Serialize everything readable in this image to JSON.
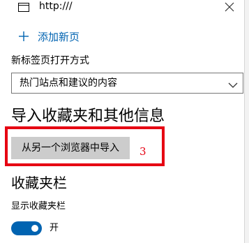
{
  "tab": {
    "url": "http:///",
    "page_icon": "page-icon",
    "close_icon": "close-icon"
  },
  "add_new_tab": {
    "icon": "plus-icon",
    "label": "添加新页"
  },
  "new_tab_open_with": {
    "label": "新标签页打开方式",
    "selected": "热门站点和建议的内容"
  },
  "import_section": {
    "heading": "导入收藏夹和其他信息",
    "button_label": "从另一个浏览器中导入",
    "step_annotation": "3"
  },
  "favorites_bar": {
    "heading": "收藏夹栏",
    "show_label": "显示收藏夹栏",
    "toggle_state": "开",
    "toggle_on": true
  },
  "colors": {
    "accent": "#0063b1",
    "annotation_red": "#e60012",
    "button_bg": "#cccccc"
  }
}
